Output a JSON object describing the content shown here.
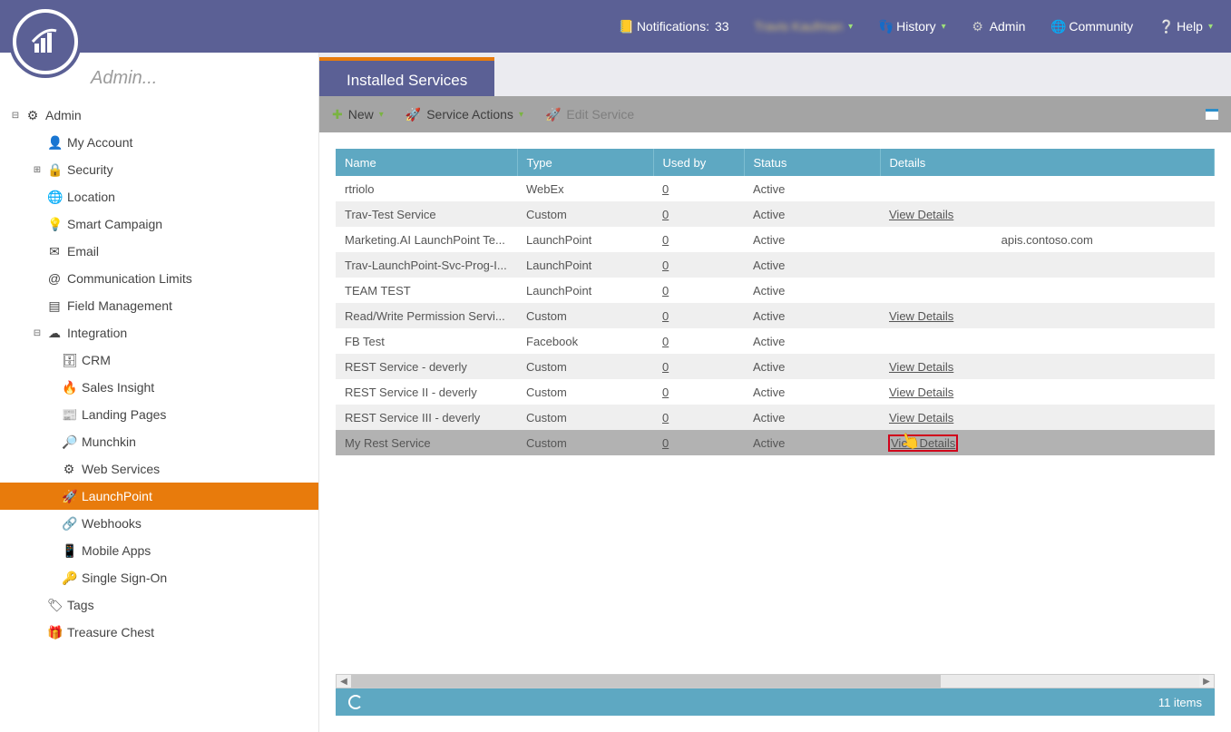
{
  "topbar": {
    "notifications_label": "Notifications:",
    "notifications_count": "33",
    "user_name": "Travis Kaufman",
    "history": "History",
    "admin": "Admin",
    "community": "Community",
    "help": "Help"
  },
  "breadcrumb": "Admin...",
  "active_tab": "Installed Services",
  "toolbar": {
    "new": "New",
    "service_actions": "Service Actions",
    "edit_service": "Edit Service"
  },
  "sidebar": [
    {
      "label": "Admin",
      "depth": 0,
      "expander": "−",
      "icon": "⚙",
      "selected": false
    },
    {
      "label": "My Account",
      "depth": 1,
      "expander": "",
      "icon": "👤",
      "selected": false
    },
    {
      "label": "Security",
      "depth": 1,
      "expander": "+",
      "icon": "🔒",
      "selected": false
    },
    {
      "label": "Location",
      "depth": 1,
      "expander": "",
      "icon": "🌐",
      "selected": false
    },
    {
      "label": "Smart Campaign",
      "depth": 1,
      "expander": "",
      "icon": "💡",
      "selected": false
    },
    {
      "label": "Email",
      "depth": 1,
      "expander": "",
      "icon": "✉",
      "selected": false
    },
    {
      "label": "Communication Limits",
      "depth": 1,
      "expander": "",
      "icon": "@",
      "selected": false
    },
    {
      "label": "Field Management",
      "depth": 1,
      "expander": "",
      "icon": "▤",
      "selected": false
    },
    {
      "label": "Integration",
      "depth": 1,
      "expander": "−",
      "icon": "☁",
      "selected": false
    },
    {
      "label": "CRM",
      "depth": 2,
      "expander": "",
      "icon": "🗄",
      "selected": false
    },
    {
      "label": "Sales Insight",
      "depth": 2,
      "expander": "",
      "icon": "🔥",
      "selected": false
    },
    {
      "label": "Landing Pages",
      "depth": 2,
      "expander": "",
      "icon": "📰",
      "selected": false
    },
    {
      "label": "Munchkin",
      "depth": 2,
      "expander": "",
      "icon": "🔎",
      "selected": false
    },
    {
      "label": "Web Services",
      "depth": 2,
      "expander": "",
      "icon": "⚙",
      "selected": false
    },
    {
      "label": "LaunchPoint",
      "depth": 2,
      "expander": "",
      "icon": "🚀",
      "selected": true
    },
    {
      "label": "Webhooks",
      "depth": 2,
      "expander": "",
      "icon": "🔗",
      "selected": false
    },
    {
      "label": "Mobile Apps",
      "depth": 2,
      "expander": "",
      "icon": "📱",
      "selected": false
    },
    {
      "label": "Single Sign-On",
      "depth": 2,
      "expander": "",
      "icon": "🔑",
      "selected": false
    },
    {
      "label": "Tags",
      "depth": 1,
      "expander": "",
      "icon": "🏷",
      "selected": false
    },
    {
      "label": "Treasure Chest",
      "depth": 1,
      "expander": "",
      "icon": "🎁",
      "selected": false
    }
  ],
  "columns": {
    "name": "Name",
    "type": "Type",
    "used_by": "Used by",
    "status": "Status",
    "details": "Details"
  },
  "rows": [
    {
      "name": "rtriolo",
      "type": "WebEx",
      "used_by": "0",
      "status": "Active",
      "details": "",
      "selected": false
    },
    {
      "name": "Trav-Test Service",
      "type": "Custom",
      "used_by": "0",
      "status": "Active",
      "details": "View Details",
      "selected": false
    },
    {
      "name": "Marketing.AI LaunchPoint Te...",
      "type": "LaunchPoint",
      "used_by": "0",
      "status": "Active",
      "details": "apis.contoso.com",
      "selected": false
    },
    {
      "name": "Trav-LaunchPoint-Svc-Prog-I...",
      "type": "LaunchPoint",
      "used_by": "0",
      "status": "Active",
      "details": "",
      "selected": false
    },
    {
      "name": "TEAM TEST",
      "type": "LaunchPoint",
      "used_by": "0",
      "status": "Active",
      "details": "",
      "selected": false
    },
    {
      "name": "Read/Write Permission Servi...",
      "type": "Custom",
      "used_by": "0",
      "status": "Active",
      "details": "View Details",
      "selected": false
    },
    {
      "name": "FB Test",
      "type": "Facebook",
      "used_by": "0",
      "status": "Active",
      "details": "",
      "selected": false
    },
    {
      "name": "REST Service - deverly",
      "type": "Custom",
      "used_by": "0",
      "status": "Active",
      "details": "View Details",
      "selected": false
    },
    {
      "name": "REST Service II - deverly",
      "type": "Custom",
      "used_by": "0",
      "status": "Active",
      "details": "View Details",
      "selected": false
    },
    {
      "name": "REST Service III - deverly",
      "type": "Custom",
      "used_by": "0",
      "status": "Active",
      "details": "View Details",
      "selected": false
    },
    {
      "name": "My Rest Service",
      "type": "Custom",
      "used_by": "0",
      "status": "Active",
      "details": "View Details",
      "selected": true
    }
  ],
  "status_item_count": "11 items"
}
